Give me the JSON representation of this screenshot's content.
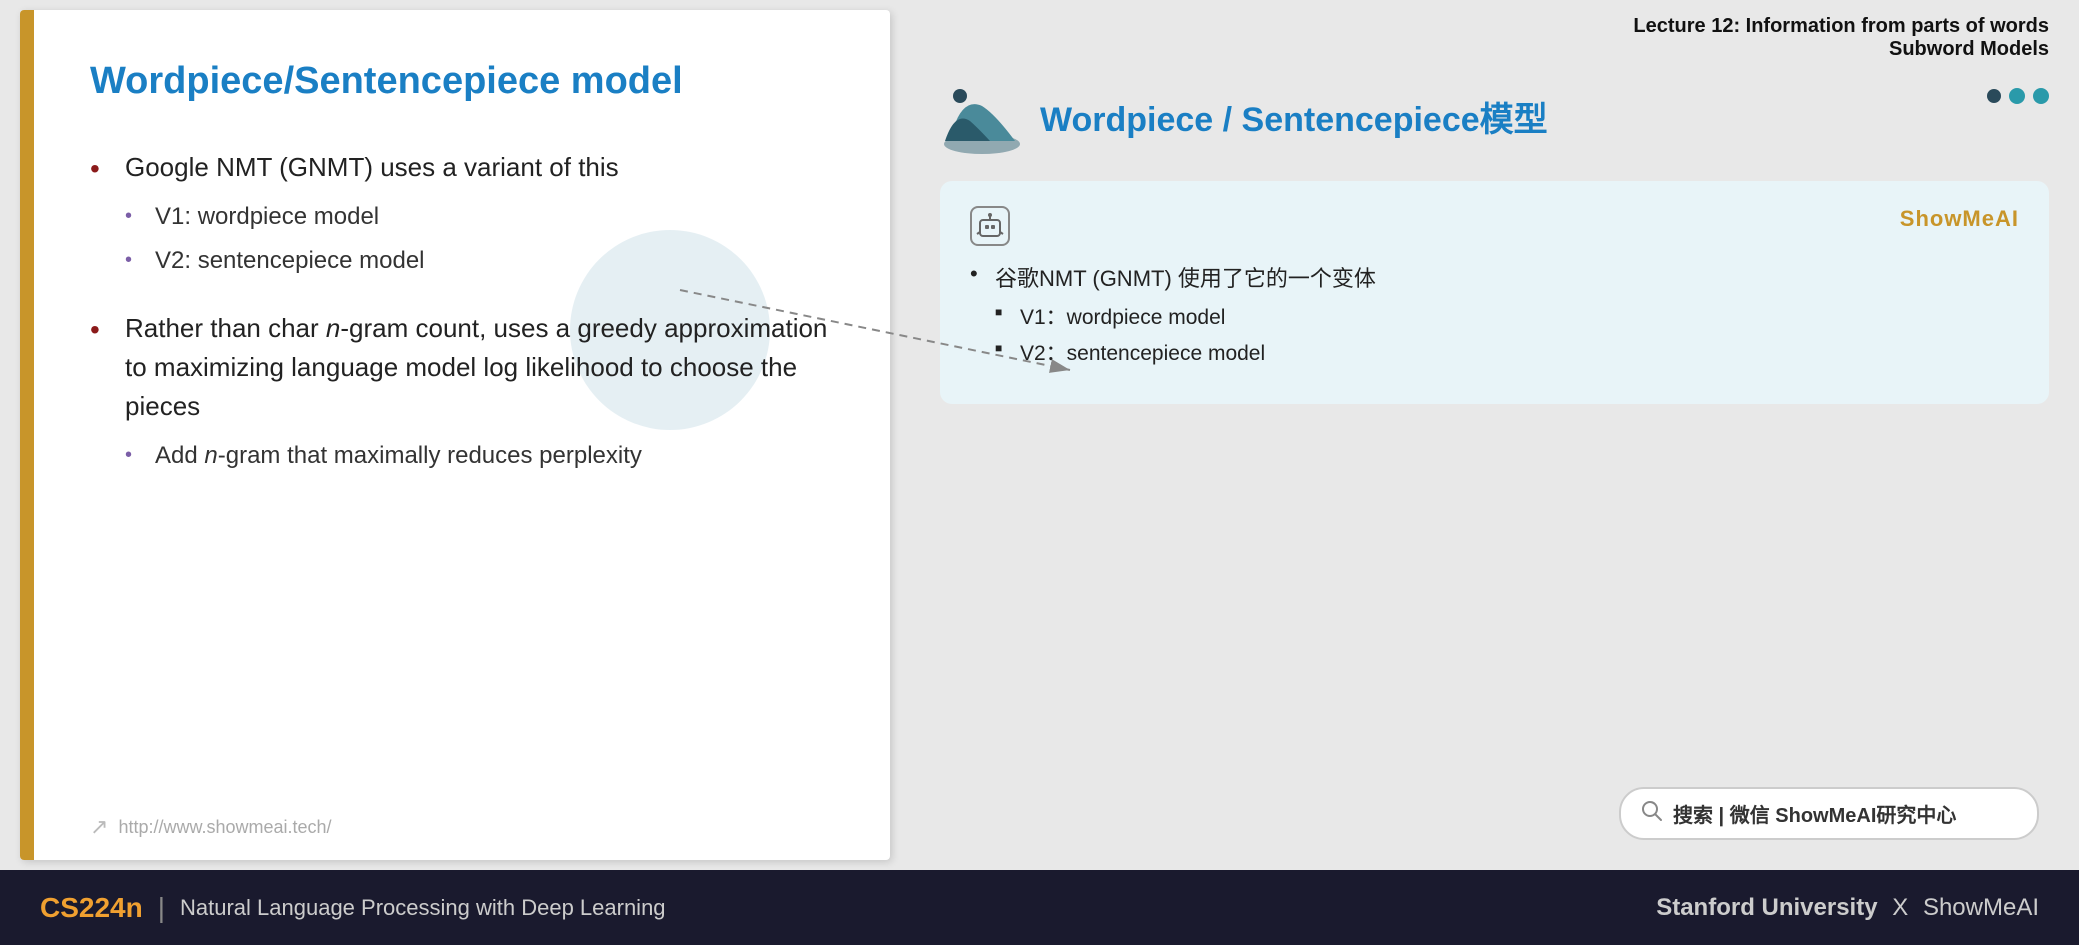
{
  "lecture": {
    "line1": "Lecture 12: Information from parts of words",
    "line2": "Subword Models"
  },
  "right_title": "Wordpiece / Sentencepiece模型",
  "dots": [
    {
      "color": "dark"
    },
    {
      "color": "teal"
    },
    {
      "color": "teal"
    }
  ],
  "left_slide": {
    "title": "Wordpiece/Sentencepiece model",
    "bullets": [
      {
        "text": "Google NMT (GNMT) uses a variant of this",
        "sub_bullets": [
          "V1: wordpiece model",
          "V2: sentencepiece model"
        ]
      },
      {
        "text_parts": [
          "Rather than char ",
          "n",
          "-gram count, uses a greedy approximation to maximizing language model log likelihood to choose the pieces"
        ],
        "sub_bullets": [
          "Add n-gram that maximally reduces perplexity"
        ]
      }
    ],
    "footer_url": "http://www.showmeai.tech/"
  },
  "card": {
    "brand": "ShowMeAI",
    "main_bullet": "谷歌NMT (GNMT) 使用了它的一个变体",
    "sub_bullets": [
      "V1：wordpiece model",
      "V2：sentencepiece model"
    ]
  },
  "search": {
    "text": "搜索 | 微信 ShowMeAI研究中心"
  },
  "bottom_bar": {
    "course_code": "CS224n",
    "divider": "|",
    "course_title": "Natural Language Processing with Deep Learning",
    "right_text": "Stanford University",
    "x": "X",
    "brand": "ShowMeAI"
  }
}
